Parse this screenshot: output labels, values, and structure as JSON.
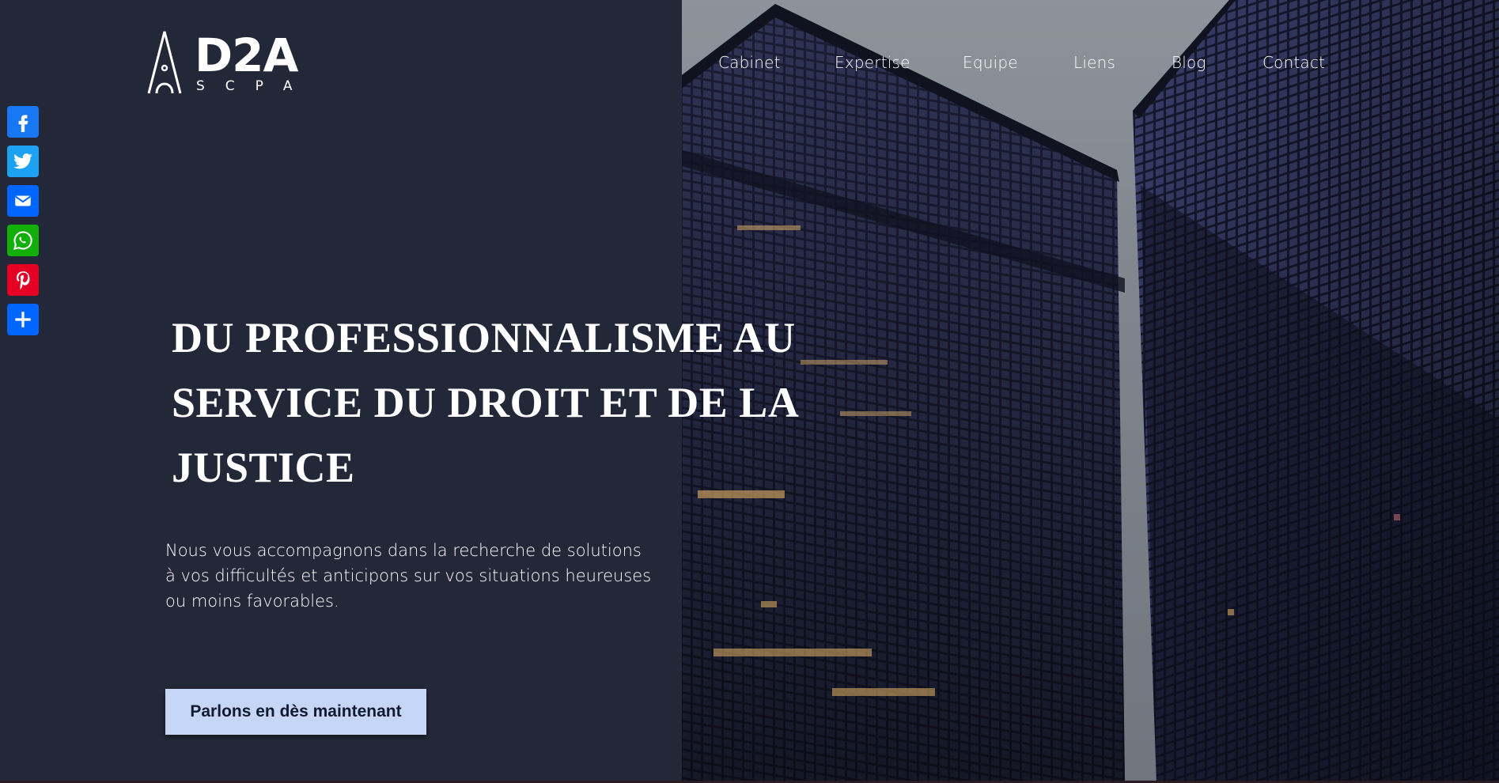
{
  "site": {
    "logo": {
      "wordmark": "D2A",
      "tagline": "SCPA"
    },
    "colors": {
      "panel_bg": "#232839",
      "cta_bg": "#c5d6f7",
      "cta_text": "#111a2e"
    }
  },
  "nav": {
    "items": [
      {
        "label": "Cabinet"
      },
      {
        "label": "Expertise"
      },
      {
        "label": "Equipe"
      },
      {
        "label": "Liens"
      },
      {
        "label": "Blog"
      },
      {
        "label": "Contact"
      }
    ]
  },
  "social": {
    "buttons": [
      {
        "icon": "facebook-icon",
        "color": "#1877f2"
      },
      {
        "icon": "twitter-icon",
        "color": "#1da1f2"
      },
      {
        "icon": "email-icon",
        "color": "#0166ff"
      },
      {
        "icon": "whatsapp-icon",
        "color": "#12af0a"
      },
      {
        "icon": "pinterest-icon",
        "color": "#e60023"
      },
      {
        "icon": "share-add-icon",
        "color": "#0166ff"
      }
    ]
  },
  "hero": {
    "headline": "DU PROFESSIONNALISME AU SERVICE DU DROIT ET DE LA JUSTICE",
    "lead": "Nous vous accompagnons dans la recherche de solutions à vos difficultés et anticipons sur vos situations heureuses ou moins favorables.",
    "cta_label": "Parlons en dès maintenant"
  }
}
